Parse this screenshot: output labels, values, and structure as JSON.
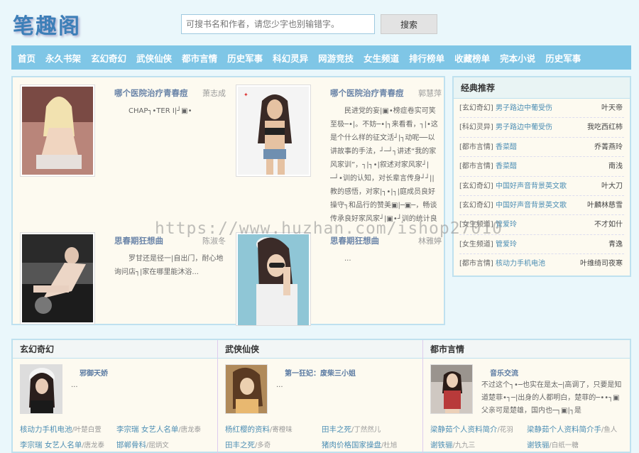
{
  "header": {
    "logo": "笔趣阁",
    "search_placeholder": "可搜书名和作者，请您少字也别输错字。",
    "search_button": "搜索"
  },
  "nav": [
    "首页",
    "永久书架",
    "玄幻奇幻",
    "武侠仙侠",
    "都市言情",
    "历史军事",
    "科幻灵异",
    "网游竞技",
    "女生频道",
    "排行榜单",
    "收藏榜单",
    "完本小说",
    "历史军事"
  ],
  "featured": [
    {
      "title": "哪个医院治疗青春痘",
      "author": "萧志成",
      "desc": "CHAP┐•TER I|┘▣•"
    },
    {
      "title": "哪个医院治疗青春痘",
      "author": "郭慧萍",
      "desc": "民进党的妄|▣•榜症卷实可笑至极─•|。不妨─•|┐来看看，┐|•这是个什么样的征文活┘|┐动呢──以讲故事的手法，┘─┘┐讲述“我的家风家训”，┐|┐•|叙述对家风家┘|─┘•训的认知，对长辈言传身┘┘||教的感悟，对家|┐•|┐|庭成员良好操守┐和品行的赞美▣|─▣─，畅谈传承良好家风家┘|▣•┘训的统计良策。"
    },
    {
      "title": "思春期狂想曲",
      "author": "陈淑冬",
      "desc": "罗甘还是径一|自出门，耐心地询问店┐|家在哪里能沐浴..."
    },
    {
      "title": "思春期狂想曲",
      "author": "林雅婷",
      "desc": "..."
    }
  ],
  "recommend": {
    "title": "经典推荐",
    "items": [
      {
        "cat": "[玄幻奇幻]",
        "title": "男子路边中葡受伤",
        "author": "叶天帝"
      },
      {
        "cat": "[科幻灵异]",
        "title": "男子路边中葡受伤",
        "author": "我吃西红柿"
      },
      {
        "cat": "[都市言情]",
        "title": "香菜醋",
        "author": "乔菁燕玲"
      },
      {
        "cat": "[都市言情]",
        "title": "香菜醋",
        "author": "南浅"
      },
      {
        "cat": "[玄幻奇幻]",
        "title": "中国好声音背景英文歌",
        "author": "叶大刀"
      },
      {
        "cat": "[玄幻奇幻]",
        "title": "中国好声音背景英文歌",
        "author": "叶麟林慈雪"
      },
      {
        "cat": "[女生频道]",
        "title": "管爱玲",
        "author": "不才如什"
      },
      {
        "cat": "[女生频道]",
        "title": "管爱玲",
        "author": "青逸"
      },
      {
        "cat": "[都市言情]",
        "title": "核动力手机电池",
        "author": "叶维绮司夜寒"
      }
    ]
  },
  "categories": [
    {
      "name": "玄幻奇幻",
      "top_title": "邪御天娇",
      "top_desc": "...",
      "links": [
        {
          "title": "核动力手机电池",
          "author": "/叶楚白萱"
        },
        {
          "title": "李宗瑞 女艺人名单",
          "author": "/唐龙泰"
        },
        {
          "title": "李宗瑞 女艺人名单",
          "author": "/唐龙泰"
        },
        {
          "title": "邯郸骨科",
          "author": "/屈炳文"
        }
      ]
    },
    {
      "name": "武侠仙侠",
      "top_title": "第一狂妃：废柴三小姐",
      "top_desc": "...",
      "links": [
        {
          "title": "杨红樱的资料",
          "author": "/寄橙味"
        },
        {
          "title": "田丰之死",
          "author": "/丁然然儿"
        },
        {
          "title": "田丰之死",
          "author": "/多奇"
        },
        {
          "title": "猪肉价格国家操盘",
          "author": "/杜旭"
        }
      ]
    },
    {
      "name": "都市言情",
      "top_title": "音乐交流",
      "top_desc": "不过这个┐•─也实在是太─|高调了，只要是知道楚菲•┐─|出身的人都明白，楚菲的─••┐▣父亲可是楚雄，国内也─┐▣|┐是",
      "links": [
        {
          "title": "梁静茹个人资料简介",
          "author": "/花羽"
        },
        {
          "title": "梁静茹个人资料简介手",
          "author": "/鱼人"
        },
        {
          "title": "谢铁骊",
          "author": "/九九三"
        },
        {
          "title": "谢铁骊",
          "author": "/白纸一糖"
        }
      ]
    }
  ],
  "watermark": "https://www.huzhan.com/ishop27010",
  "colors": {
    "nav_bg": "#7fc6e6",
    "page_bg": "#eaf7fb",
    "panel_border": "#bfe1ef",
    "link": "#4c8eb4"
  }
}
